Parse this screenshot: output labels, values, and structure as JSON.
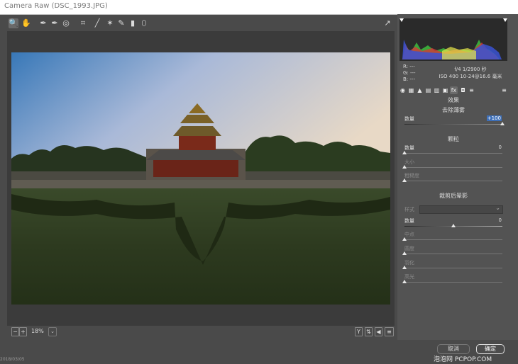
{
  "window": {
    "title": "Camera Raw (DSC_1993.JPG)"
  },
  "toolbar": {
    "tools": [
      "zoom-tool",
      "hand-tool",
      "white-balance-tool",
      "color-sampler-tool",
      "targeted-adjustment-tool",
      "crop-tool",
      "straighten-tool",
      "spot-removal-tool",
      "red-eye-tool",
      "adjustment-brush-tool",
      "graduated-filter-tool",
      "radial-filter-tool"
    ],
    "fullscreen": "fullscreen-toggle"
  },
  "bottom": {
    "zoom": "18%",
    "zoom_dropdown": "⌄"
  },
  "histogram": {
    "values": {
      "r": "R:  ---",
      "g": "G:  ---",
      "b": "B:  ---"
    },
    "exposure": {
      "line1": "f/4   1/2900 秒",
      "line2": "ISO 400   10-24@16.6 毫米"
    }
  },
  "panel_tabs": [
    "basic",
    "tone-curve",
    "detail",
    "hsl",
    "split-toning",
    "lens-corrections",
    "effects",
    "camera-calibration",
    "presets"
  ],
  "effects": {
    "panel_title": "效果",
    "dehaze": {
      "title": "去除薄雾",
      "label": "数量",
      "value": "+100",
      "fraction": 1.0
    },
    "grain": {
      "title": "颗粒",
      "amount": {
        "label": "数量",
        "value": "0",
        "fraction": 0.0
      },
      "size": {
        "label": "大小",
        "fraction": 0.0
      },
      "roughness": {
        "label": "粗糙度",
        "fraction": 0.0
      }
    },
    "vignette": {
      "title": "裁剪后晕影",
      "style": {
        "label": "样式"
      },
      "amount": {
        "label": "数量",
        "value": "0",
        "fraction": 0.5
      },
      "midpoint": {
        "label": "中点",
        "fraction": 0.0
      },
      "roundness": {
        "label": "圆度",
        "fraction": 0.0
      },
      "feather": {
        "label": "羽化",
        "fraction": 0.0
      },
      "highlights": {
        "label": "高光",
        "fraction": 0.0
      }
    }
  },
  "buttons": {
    "cancel": "取消",
    "ok": "确定"
  },
  "watermark": "泡泡网 PCPOP.COM",
  "corner_text": "2018/03/05"
}
